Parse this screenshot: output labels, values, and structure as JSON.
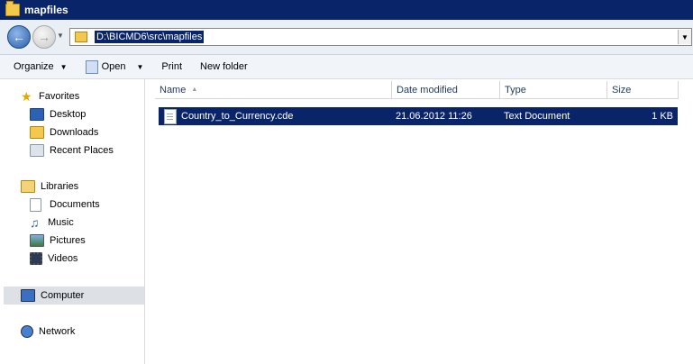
{
  "window": {
    "title": "mapfiles"
  },
  "address": {
    "path": "D:\\BICMD6\\src\\mapfiles"
  },
  "toolbar": {
    "organize": "Organize",
    "open": "Open",
    "print": "Print",
    "new_folder": "New folder"
  },
  "sidebar": {
    "favorites": {
      "label": "Favorites",
      "items": [
        "Desktop",
        "Downloads",
        "Recent Places"
      ]
    },
    "libraries": {
      "label": "Libraries",
      "items": [
        "Documents",
        "Music",
        "Pictures",
        "Videos"
      ]
    },
    "computer": "Computer",
    "network": "Network"
  },
  "columns": {
    "name": "Name",
    "date": "Date modified",
    "type": "Type",
    "size": "Size"
  },
  "files": [
    {
      "name": "Country_to_Currency.cde",
      "date": "21.06.2012 11:26",
      "type": "Text Document",
      "size": "1 KB",
      "selected": true
    }
  ]
}
